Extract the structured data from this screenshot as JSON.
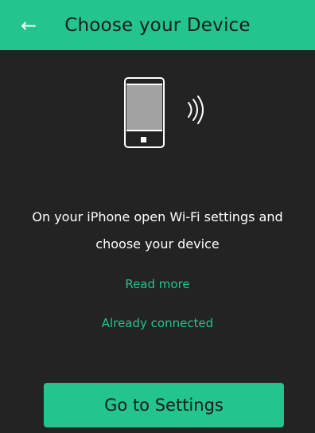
{
  "header": {
    "back_icon": "←",
    "title": "Choose your Device"
  },
  "illustration": {
    "icon": "phone-with-wifi-signal-icon"
  },
  "instruction_line_1": "On your iPhone open Wi-Fi settings and",
  "instruction_line_2": "choose your device",
  "links": {
    "read_more": "Read more",
    "already_connected": "Already connected"
  },
  "buttons": {
    "go_to_settings": "Go to Settings"
  },
  "colors": {
    "accent": "#23c48e",
    "background": "#232323",
    "text": "#ffffff",
    "dark_text": "#1b1b1b"
  }
}
